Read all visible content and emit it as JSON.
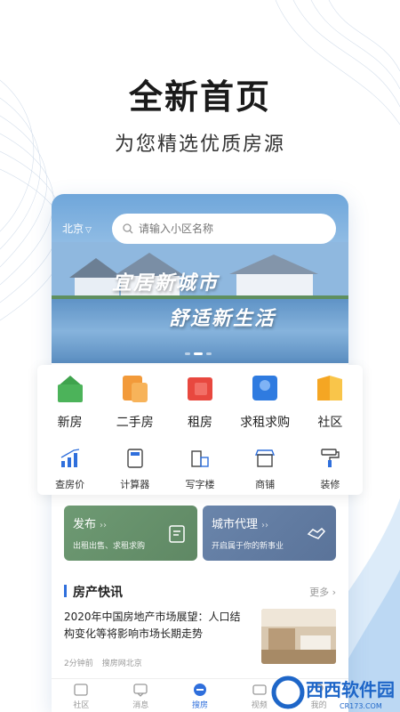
{
  "hero": {
    "title": "全新首页",
    "subtitle": "为您精选优质房源"
  },
  "banner": {
    "city": "北京",
    "search_placeholder": "请输入小区名称",
    "line1": "宜居新城市",
    "line2": "舒适新生活",
    "slide_count": 3,
    "active_slide": 2
  },
  "menu": {
    "primary": [
      {
        "label": "新房",
        "icon": "new-house-icon"
      },
      {
        "label": "二手房",
        "icon": "second-hand-house-icon"
      },
      {
        "label": "租房",
        "icon": "rent-house-icon"
      },
      {
        "label": "求租求购",
        "icon": "want-rent-buy-icon"
      },
      {
        "label": "社区",
        "icon": "community-icon"
      }
    ],
    "secondary": [
      {
        "label": "查房价",
        "icon": "price-chart-icon"
      },
      {
        "label": "计算器",
        "icon": "calculator-icon"
      },
      {
        "label": "写字楼",
        "icon": "office-building-icon"
      },
      {
        "label": "商铺",
        "icon": "shop-icon"
      },
      {
        "label": "装修",
        "icon": "paint-roller-icon"
      }
    ]
  },
  "promos": [
    {
      "title": "发布",
      "arrows": "››",
      "desc": "出租出售、求租求购",
      "icon": "publish-icon",
      "color": "#6e9a73"
    },
    {
      "title": "城市代理",
      "arrows": "››",
      "desc": "开启属于你的新事业",
      "icon": "handshake-icon",
      "color": "#6a85ab"
    }
  ],
  "news": {
    "section_title": "房产快讯",
    "more_label": "更多",
    "item": {
      "title": "2020年中国房地产市场展望：人口结构变化等将影响市场长期走势",
      "time": "2分钟前",
      "source": "搜房网北京"
    }
  },
  "tabbar": [
    {
      "label": "社区",
      "icon": "community-tab-icon",
      "active": false
    },
    {
      "label": "消息",
      "icon": "message-tab-icon",
      "active": false
    },
    {
      "label": "搜房",
      "icon": "search-house-tab-icon",
      "active": true
    },
    {
      "label": "视频",
      "icon": "video-tab-icon",
      "active": false
    },
    {
      "label": "我的",
      "icon": "profile-tab-icon",
      "active": false
    }
  ],
  "watermark": {
    "brand": "西西软件园",
    "url": "CR173.COM"
  },
  "colors": {
    "accent": "#2f6fdc",
    "promo_green": "#6e9a73",
    "promo_blue": "#6a85ab"
  }
}
